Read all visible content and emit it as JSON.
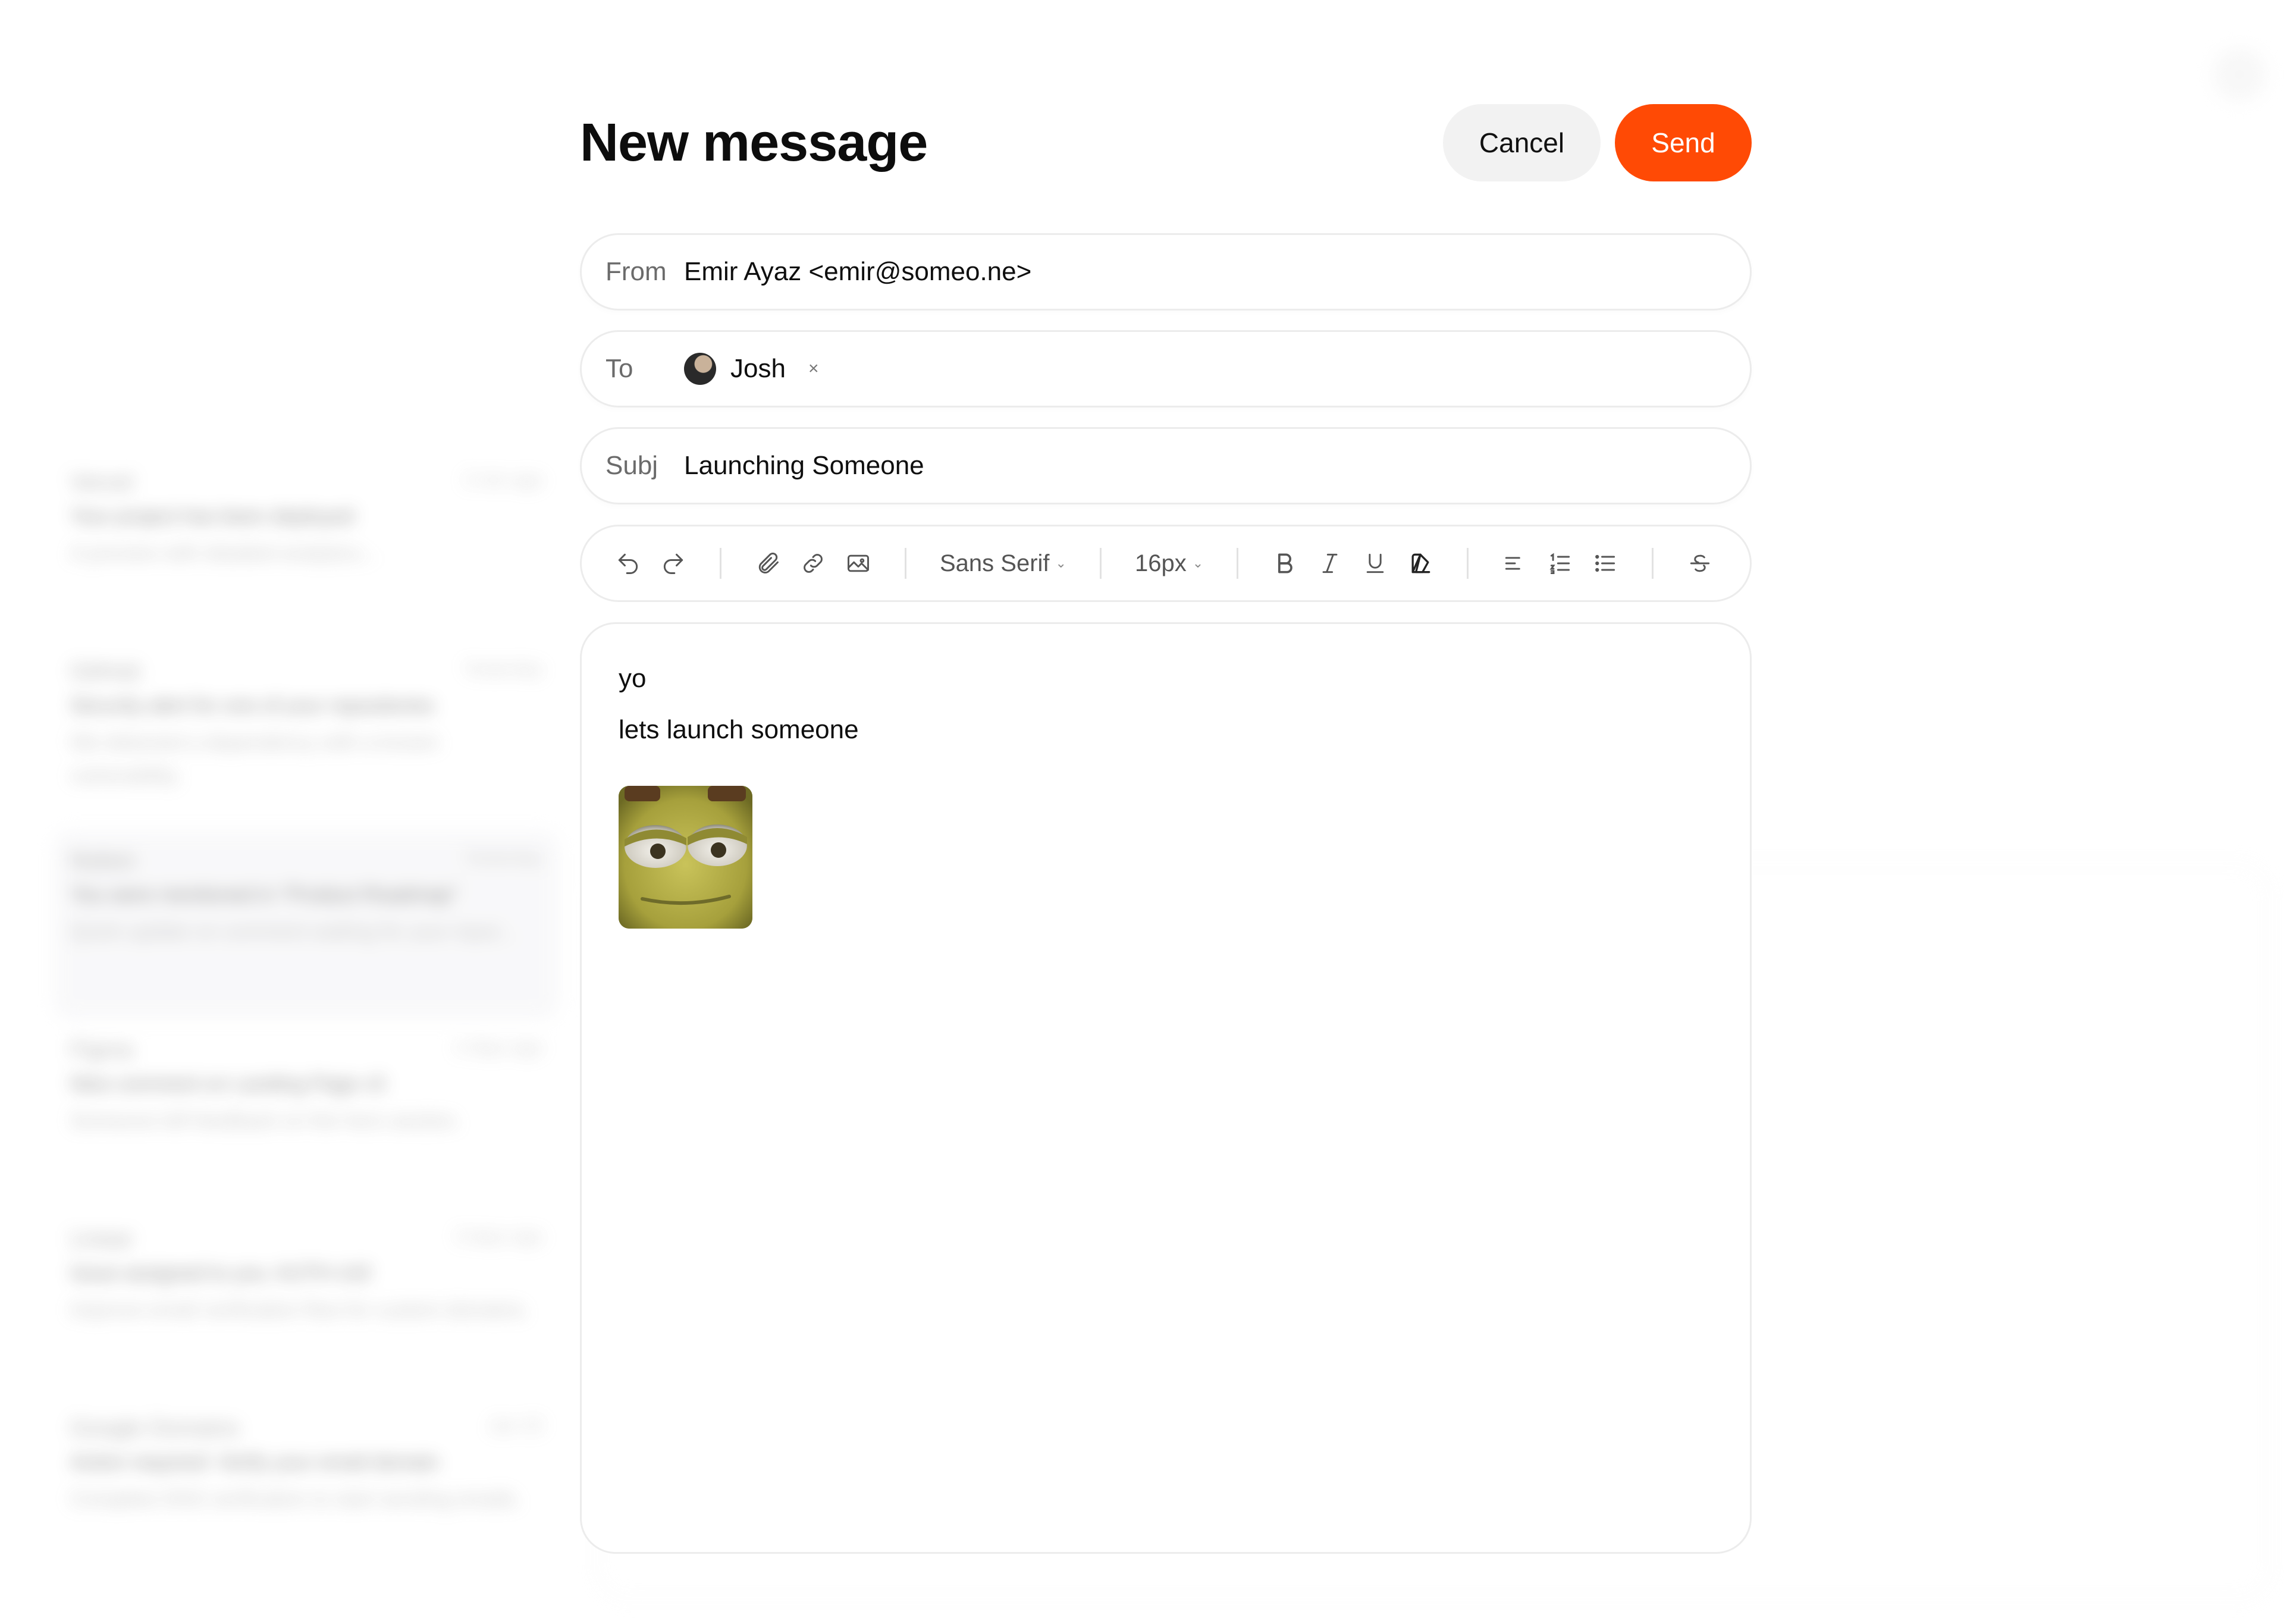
{
  "background": {
    "mail_list": [
      {
        "sender": "Vercel",
        "date": "2 min ago",
        "subject": "Your project has been deployed",
        "preview": "A preview with detailed analytics..."
      },
      {
        "sender": "GitHub",
        "date": "Yesterday",
        "subject": "Security alert for one of your repositories",
        "preview": "We detected a dependency with a known vulnerability."
      },
      {
        "sender": "Notion",
        "date": "Yesterday",
        "subject": "You were mentioned in \"Product Roadmap\"",
        "preview": "Quick update on comment waiting for your input..."
      },
      {
        "sender": "Figma",
        "date": "2 days ago",
        "subject": "New comment on Landing Page v3",
        "preview": "Someone left feedback on the hero section."
      },
      {
        "sender": "Linear",
        "date": "3 days ago",
        "subject": "Issue assigned to you: AUTH-142",
        "preview": "Improve email verification flow for custom domains."
      },
      {
        "sender": "Google Domains",
        "date": "Jan 23",
        "subject": "Action required: Verify your email domain",
        "preview": "Complete DNS verification to start sending emails."
      }
    ]
  },
  "compose": {
    "title": "New message",
    "cancel_label": "Cancel",
    "send_label": "Send",
    "from_label": "From",
    "from_value": "Emir Ayaz <emir@someo.ne>",
    "to_label": "To",
    "to_recipient": "Josh",
    "remove_glyph": "×",
    "subj_label": "Subj",
    "subj_value": "Launching Someone"
  },
  "toolbar": {
    "font_family": "Sans Serif",
    "font_size": "16px",
    "chevron": "⌄",
    "icons": [
      "undo-icon",
      "redo-icon",
      "attachment-icon",
      "link-icon",
      "image-icon",
      "bold-icon",
      "italic-icon",
      "underline-icon",
      "highlight-icon",
      "align-icon",
      "ordered-list-icon",
      "bullet-list-icon",
      "strikethrough-icon"
    ]
  },
  "body": {
    "line1": "yo",
    "line2": "lets launch someone",
    "image_alt": "attached-image"
  },
  "colors": {
    "send": "#ff4a05",
    "border": "#ececec",
    "label": "#6b6b6b"
  }
}
